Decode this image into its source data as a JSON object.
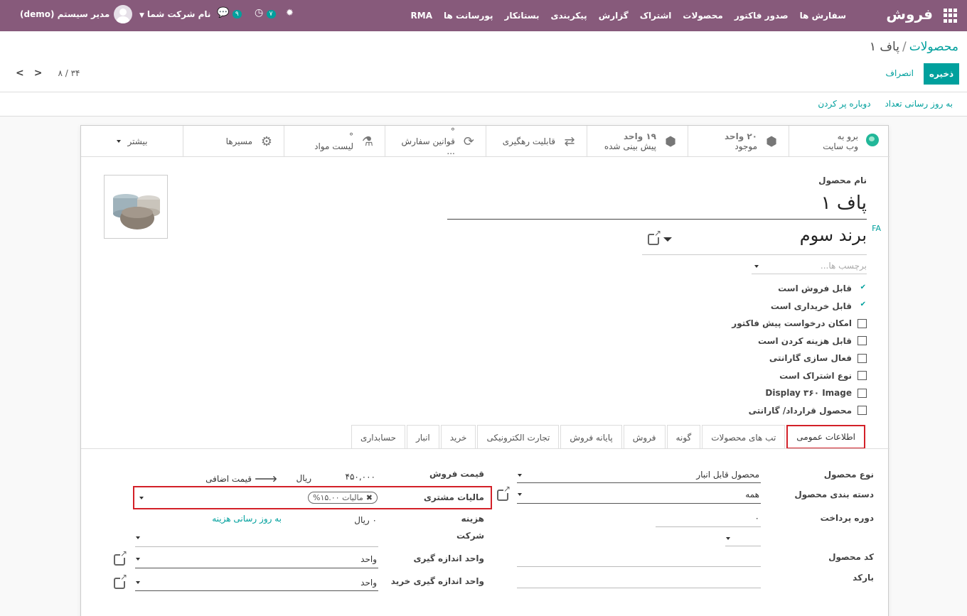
{
  "navbar": {
    "brand": "فروش",
    "menu": [
      "سفارش ها",
      "صدور فاکتور",
      "محصولات",
      "اشتراک",
      "گزارش",
      "پیکربندی",
      "بستانکار",
      "پورسانت ها",
      "RMA"
    ],
    "chat_count": "۹",
    "activity_count": "۷",
    "company": "نام شرکت شما",
    "user": "مدیر سیستم (demo)"
  },
  "breadcrumb": {
    "parent": "محصولات",
    "sep": "/",
    "current": "پاف ۱"
  },
  "buttons": {
    "save": "ذخیره",
    "discard": "انصراف"
  },
  "pager": {
    "value": "۸ / ۳۴"
  },
  "actions": [
    "به روز رسانی تعداد",
    "دوباره پر کردن"
  ],
  "smart_buttons": [
    {
      "line1": "برو به",
      "line2": "وب سایت",
      "icon": "globe-icon"
    },
    {
      "line1": "۲۰ واحد",
      "line2": "موجود",
      "icon": "cubes-icon"
    },
    {
      "line1": "۱۹ واحد",
      "line2": "پیش بینی شده",
      "icon": "cubes-icon"
    },
    {
      "line1": "",
      "line2": "قابلیت رهگیری",
      "icon": "exchange-icon"
    },
    {
      "line1": "°",
      "line2": "قوانین سفارش ...",
      "icon": "refresh-icon"
    },
    {
      "line1": "°",
      "line2": "لیست مواد",
      "icon": "flask-icon"
    },
    {
      "line1": "",
      "line2": "مسیرها",
      "icon": "cogs-icon"
    },
    {
      "line1": "",
      "line2": "بیشتر",
      "icon": "caret-down-icon"
    }
  ],
  "product": {
    "name_label": "نام محصول",
    "name": "پاف ۱",
    "lang": "FA",
    "brand": "برند سوم",
    "tags_placeholder": "برچسب ها..."
  },
  "checkboxes": [
    {
      "label": "قابل فروش است",
      "checked": true
    },
    {
      "label": "قابل خریداری است",
      "checked": true
    },
    {
      "label": "امکان درخواست پیش فاکتور",
      "checked": false
    },
    {
      "label": "قابل هزینه کردن است",
      "checked": false
    },
    {
      "label": "فعال سازی گارانتی",
      "checked": false
    },
    {
      "label": "نوع اشتراک است",
      "checked": false
    },
    {
      "label": "Display ۳۶۰ Image",
      "checked": false
    },
    {
      "label": "محصول قرارداد/ گارانتی",
      "checked": false
    }
  ],
  "tabs": [
    "اطلاعات عمومی",
    "تب های محصولات",
    "گونه",
    "فروش",
    "پایانه فروش",
    "تجارت الکترونیکی",
    "خرید",
    "انبار",
    "حسابداری"
  ],
  "form": {
    "product_type_label": "نوع محصول",
    "product_type": "محصول قابل انبار",
    "category_label": "دسته بندی محصول",
    "category": "همه",
    "payment_term_label": "دوره پرداخت",
    "payment_term": "۰",
    "code_label": "کد محصول",
    "barcode_label": "بارکد",
    "sale_price_label": "قیمت فروش",
    "sale_price": "۴۵۰,۰۰۰",
    "currency": "ریال",
    "extra_price": "قیمت اضافی",
    "customer_tax_label": "مالیات مشتری",
    "customer_tax": "مالیات ۱۵.۰۰%",
    "cost_label": "هزینه",
    "cost": "۰ ریال",
    "update_cost": "به روز رسانی هزینه",
    "company_label": "شرکت",
    "uom_label": "واحد اندازه گیری",
    "uom": "واحد",
    "purchase_uom_label": "واحد اندازه گیری خرید",
    "purchase_uom": "واحد"
  }
}
